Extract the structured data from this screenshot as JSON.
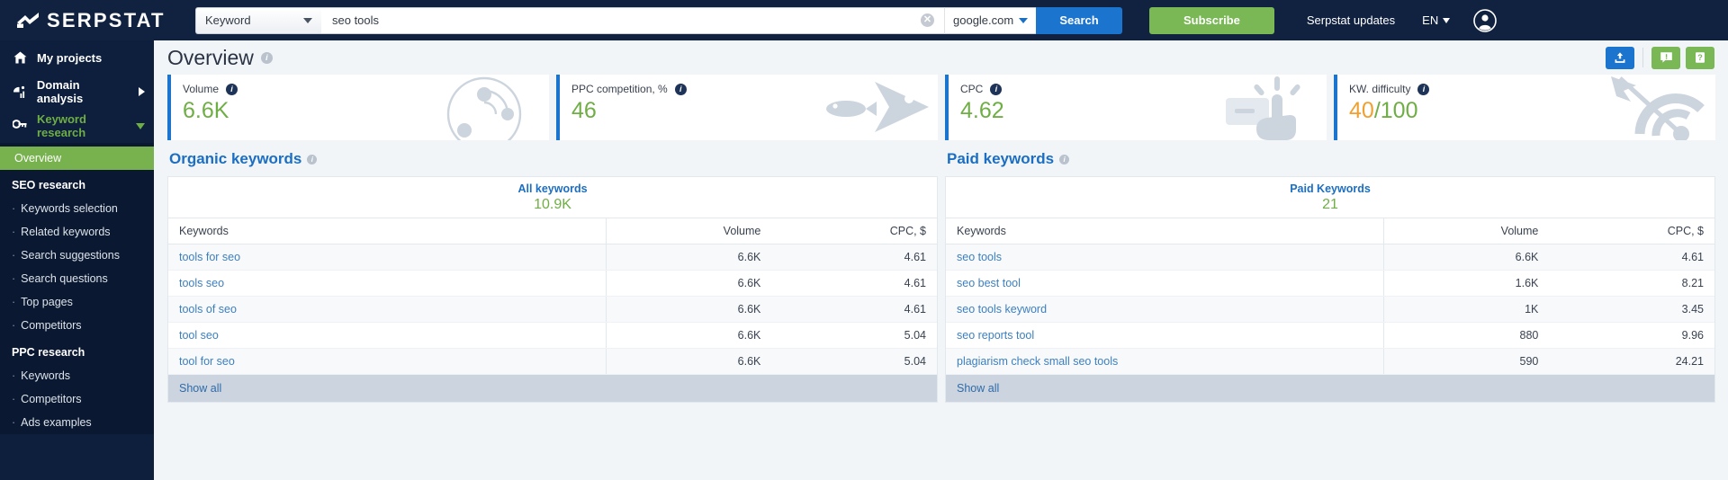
{
  "topbar": {
    "logo_text": "SERPSTAT",
    "logo_icon": "serpstat-logo-icon",
    "search_type": "Keyword",
    "search_type_caret": "chevron-down-icon",
    "keyword_value": "seo tools",
    "keyword_placeholder": "",
    "clear_icon": "clear-circle-icon",
    "clear_glyph": "✕",
    "database": "google.com",
    "database_caret": "chevron-down-icon",
    "search_button": "Search",
    "subscribe_button": "Subscribe",
    "updates_link": "Serpstat updates",
    "language": "EN",
    "language_caret": "chevron-down-icon",
    "avatar_icon": "user-avatar-icon"
  },
  "sidebar": {
    "top_items": [
      {
        "label": "My projects",
        "icon": "home-icon",
        "expander": "none",
        "active": false
      },
      {
        "label": "Domain analysis",
        "icon": "domain-chart-icon",
        "expander": "arrow-right-icon",
        "active": false
      },
      {
        "label": "Keyword research",
        "icon": "key-icon",
        "expander": "arrow-down-icon",
        "active": true
      }
    ],
    "overview_item": "Overview",
    "groups": [
      {
        "title": "SEO research",
        "items": [
          "Keywords selection",
          "Related keywords",
          "Search suggestions",
          "Search questions",
          "Top pages",
          "Competitors"
        ]
      },
      {
        "title": "PPC research",
        "items": [
          "Keywords",
          "Competitors",
          "Ads examples"
        ]
      }
    ],
    "bullet": "·"
  },
  "page": {
    "title": "Overview",
    "title_info_icon": "info-icon",
    "info_glyph": "i",
    "actions": [
      {
        "name": "export-button",
        "icon": "upload-icon",
        "style": "blue"
      },
      {
        "name": "feedback-button",
        "icon": "comment-alert-icon",
        "style": "green"
      },
      {
        "name": "help-button",
        "icon": "help-book-icon",
        "style": "green"
      }
    ]
  },
  "cards": [
    {
      "label": "Volume",
      "value": "6.6K",
      "value2": "",
      "art": "radar-chart-art",
      "info_icon": "info-icon"
    },
    {
      "label": "PPC competition, %",
      "value": "46",
      "value2": "",
      "art": "fish-art",
      "info_icon": "info-icon"
    },
    {
      "label": "CPC",
      "value": "4.62",
      "value2": "",
      "art": "hand-press-art",
      "info_icon": "info-icon"
    },
    {
      "label": "KW. difficulty",
      "value": "40",
      "value2": "/100",
      "art": "target-arrow-art",
      "info_icon": "info-icon"
    }
  ],
  "organic": {
    "section_title": "Organic keywords",
    "section_info_icon": "info-icon",
    "summary_label": "All keywords",
    "summary_value": "10.9K",
    "columns": [
      "Keywords",
      "Volume",
      "CPC, $"
    ],
    "rows": [
      {
        "keyword": "tools for seo",
        "volume": "6.6K",
        "cpc": "4.61"
      },
      {
        "keyword": "tools seo",
        "volume": "6.6K",
        "cpc": "4.61"
      },
      {
        "keyword": "tools of seo",
        "volume": "6.6K",
        "cpc": "4.61"
      },
      {
        "keyword": "tool seo",
        "volume": "6.6K",
        "cpc": "5.04"
      },
      {
        "keyword": "tool for seo",
        "volume": "6.6K",
        "cpc": "5.04"
      }
    ],
    "show_all": "Show all"
  },
  "paid": {
    "section_title": "Paid keywords",
    "section_info_icon": "info-icon",
    "summary_label": "Paid Keywords",
    "summary_value": "21",
    "columns": [
      "Keywords",
      "Volume",
      "CPC, $"
    ],
    "rows": [
      {
        "keyword": "seo tools",
        "volume": "6.6K",
        "cpc": "4.61"
      },
      {
        "keyword": "seo best tool",
        "volume": "1.6K",
        "cpc": "8.21"
      },
      {
        "keyword": "seo tools keyword",
        "volume": "1K",
        "cpc": "3.45"
      },
      {
        "keyword": "seo reports tool",
        "volume": "880",
        "cpc": "9.96"
      },
      {
        "keyword": "plagiarism check small seo tools",
        "volume": "590",
        "cpc": "24.21"
      }
    ],
    "show_all": "Show all"
  },
  "colors": {
    "navy": "#112240",
    "sidebar": "#0d1f3c",
    "green": "#7ab855",
    "blue": "#1b74cd",
    "link_blue": "#3d7fbf",
    "value_green": "#6fae45",
    "orange": "#f0a030",
    "page_bg": "#f2f5f8"
  }
}
